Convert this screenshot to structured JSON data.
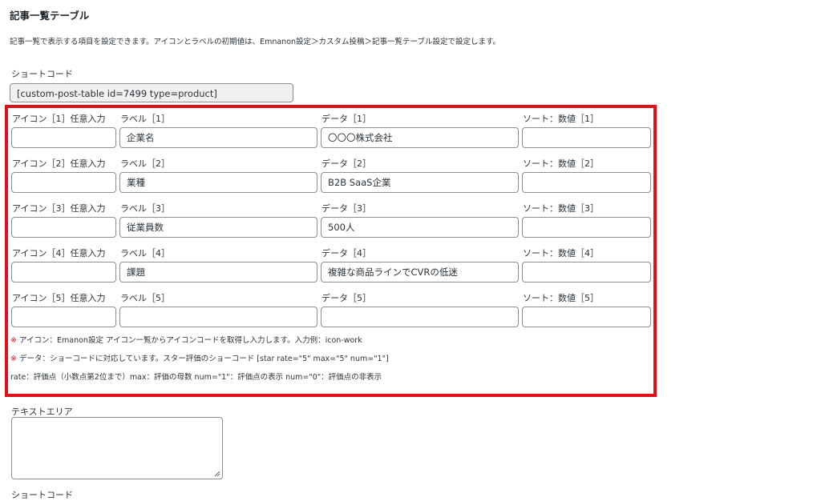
{
  "section": {
    "title": "記事一覧テーブル",
    "description": "記事一覧で表示する項目を設定できます。アイコンとラベルの初期値は、Emnanon設定＞カスタム投稿＞記事一覧テーブル設定で設定します。"
  },
  "shortcode": {
    "label": "ショートコード",
    "value": "[custom-post-table id=7499 type=product]"
  },
  "rows": [
    {
      "icon_label": "アイコン［1］任意入力",
      "label_label": "ラベル［1］",
      "label_value": "企業名",
      "data_label": "データ［1］",
      "data_value": "〇〇〇株式会社",
      "sort_label": "ソート：数値［1］",
      "sort_value": ""
    },
    {
      "icon_label": "アイコン［2］任意入力",
      "label_label": "ラベル［2］",
      "label_value": "業種",
      "data_label": "データ［2］",
      "data_value": "B2B SaaS企業",
      "sort_label": "ソート：数値［2］",
      "sort_value": ""
    },
    {
      "icon_label": "アイコン［3］任意入力",
      "label_label": "ラベル［3］",
      "label_value": "従業員数",
      "data_label": "データ［3］",
      "data_value": "500人",
      "sort_label": "ソート：数値［3］",
      "sort_value": ""
    },
    {
      "icon_label": "アイコン［4］任意入力",
      "label_label": "ラベル［4］",
      "label_value": "課題",
      "data_label": "データ［4］",
      "data_value": "複雑な商品ラインでCVRの低迷",
      "sort_label": "ソート：数値［4］",
      "sort_value": ""
    },
    {
      "icon_label": "アイコン［5］任意入力",
      "label_label": "ラベル［5］",
      "label_value": "",
      "data_label": "データ［5］",
      "data_value": "",
      "sort_label": "ソート：数値［5］",
      "sort_value": ""
    }
  ],
  "notes": {
    "mark": "※",
    "icon_note": "アイコン：Emanon設定 アイコン一覧からアイコンコードを取得し入力します。入力例：icon-work",
    "data_note": "データ：ショーコードに対応しています。スター評価のショーコード [star rate=\"5\" max=\"5\" num=\"1\"]",
    "rate_note": "rate：評価点（小数点第2位まで）max：評価の母数 num=\"1\"：評価点の表示 num=\"0\"：評価点の非表示"
  },
  "textarea": {
    "label": "テキストエリア",
    "value": ""
  },
  "shortcode2": {
    "label": "ショートコード"
  },
  "colors": {
    "highlight_border": "#e0101a",
    "input_border": "#8c8f94",
    "readonly_bg": "#f0f0f1"
  }
}
